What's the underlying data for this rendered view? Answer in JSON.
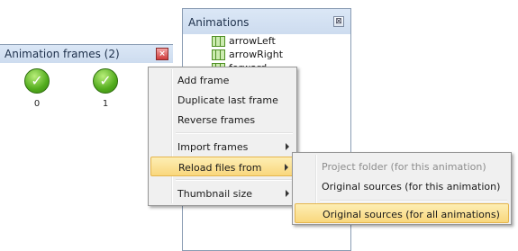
{
  "animations_panel": {
    "title": "Animations",
    "items": [
      {
        "label": "arrowLeft",
        "icon": "animation-strip-icon"
      },
      {
        "label": "arrowRight",
        "icon": "animation-strip-icon"
      },
      {
        "label": "forward",
        "icon": "animation-strip-icon"
      }
    ]
  },
  "frames_panel": {
    "title": "Animation frames (2)",
    "frames": [
      {
        "number": "0",
        "icon": "checkmark-icon"
      },
      {
        "number": "1",
        "icon": "checkmark-icon"
      }
    ]
  },
  "context_menu": {
    "items": [
      {
        "label": "Add frame"
      },
      {
        "label": "Duplicate last frame"
      },
      {
        "label": "Reverse frames"
      },
      {
        "label": "Import frames",
        "has_submenu": true
      },
      {
        "label": "Reload files from",
        "has_submenu": true,
        "highlighted": true
      },
      {
        "label": "Thumbnail size",
        "has_submenu": true
      }
    ]
  },
  "submenu": {
    "items": [
      {
        "label": "Project folder (for this animation)",
        "disabled": true
      },
      {
        "label": "Original sources (for this animation)"
      },
      {
        "label": "Original sources (for all animations)",
        "highlighted": true
      }
    ]
  },
  "colors": {
    "highlight": "#f9d77d",
    "panel_header": "#cddcef",
    "check_green": "#52ac1d",
    "close_red": "#cf3b3b"
  }
}
